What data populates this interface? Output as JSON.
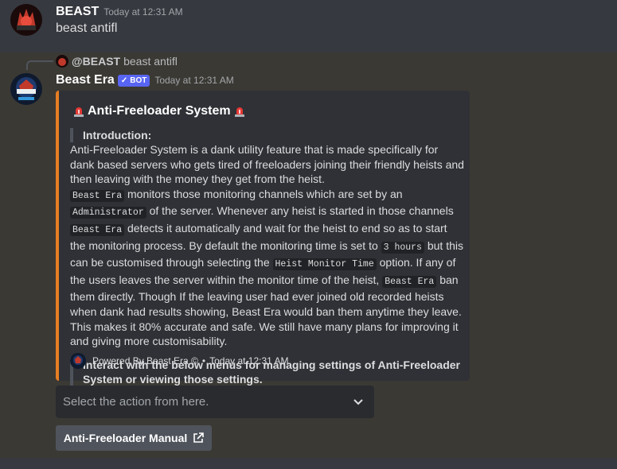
{
  "message1": {
    "username": "BEAST",
    "timestamp": "Today at 12:31 AM",
    "content": "beast antifl"
  },
  "message2": {
    "reply": {
      "author": "@BEAST",
      "content": "beast antifl"
    },
    "username": "Beast Era",
    "bot_tag": "BOT",
    "timestamp": "Today at 12:31 AM",
    "embed": {
      "accent_color": "#e67e22",
      "title": "Anti-Freeloader System",
      "intro_label": "Introduction:",
      "description": [
        {
          "t": "text",
          "v": "Anti-Freeloader System is a dank utility feature that is made specifically for dank based servers who gets tired of freeloaders joining their friendly heists and then leaving with the money they get from the heist."
        },
        {
          "t": "br"
        },
        {
          "t": "code",
          "v": "Beast Era"
        },
        {
          "t": "text",
          "v": " monitors those monitoring channels which are set by an "
        },
        {
          "t": "code",
          "v": "Administrator"
        },
        {
          "t": "text",
          "v": " of the server. Whenever any heist is started in those channels "
        },
        {
          "t": "code",
          "v": "Beast Era"
        },
        {
          "t": "text",
          "v": " detects it automatically and wait for the heist to end so as to start the monitoring process. By default the monitoring time is set to "
        },
        {
          "t": "code",
          "v": "3 hours"
        },
        {
          "t": "text",
          "v": " but this can be customised through selecting the "
        },
        {
          "t": "code",
          "v": "Heist Monitor Time"
        },
        {
          "t": "text",
          "v": " option. If any of the users leaves the server within the monitor time of the heist, "
        },
        {
          "t": "code",
          "v": "Beast Era"
        },
        {
          "t": "text",
          "v": " ban them directly. Though If the leaving user had ever joined old recorded heists when dank had results showing, Beast Era would ban them anytime they leave. This makes it 80% accurate and safe. We still have many plans for improving it and giving more customisability."
        }
      ],
      "closing_quote": "Interact with the below menus for managing settings of Anti-Freeloader System or viewing those settings.",
      "footer_text": "Powered By Beast Era ©",
      "footer_timestamp": "Today at 12:31 AM"
    },
    "select_placeholder": "Select the action from here.",
    "button_label": "Anti-Freeloader Manual"
  }
}
